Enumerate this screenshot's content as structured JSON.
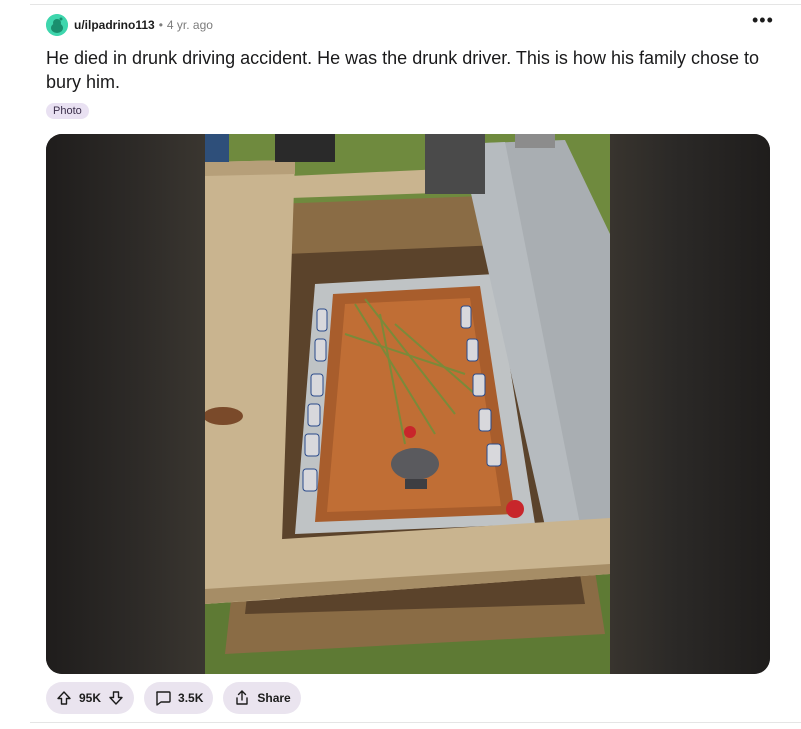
{
  "post": {
    "username": "u/ilpadrino113",
    "separator": "•",
    "age": "4 yr. ago",
    "more_label": "•••",
    "title": "He died in drunk driving accident. He was the drunk driver. This is how his family chose to bury him.",
    "flair": "Photo"
  },
  "actions": {
    "votes": "95K",
    "comments": "3.5K",
    "share": "Share"
  },
  "icons": {
    "avatar": "snoo-avatar-icon",
    "more": "more-options-icon",
    "upvote": "upvote-arrow-icon",
    "downvote": "downvote-arrow-icon",
    "comment": "comment-bubble-icon",
    "share": "share-icon"
  },
  "colors": {
    "avatar_bg": "#3ed6ad",
    "flair_bg": "#e9e1f2",
    "action_bg": "#eae4ef"
  }
}
